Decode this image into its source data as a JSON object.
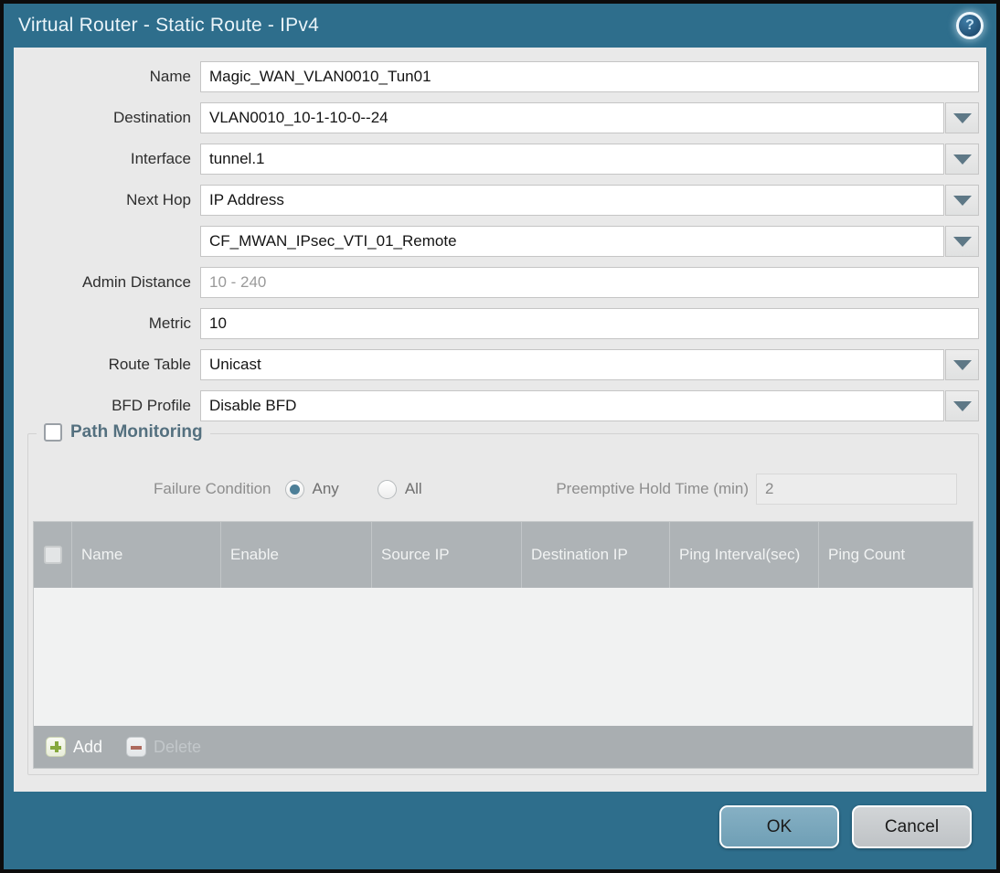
{
  "dialog": {
    "title": "Virtual Router - Static Route - IPv4",
    "help_glyph": "?"
  },
  "form": {
    "name": {
      "label": "Name",
      "value": "Magic_WAN_VLAN0010_Tun01"
    },
    "destination": {
      "label": "Destination",
      "value": "VLAN0010_10-1-10-0--24"
    },
    "interface": {
      "label": "Interface",
      "value": "tunnel.1"
    },
    "next_hop": {
      "label": "Next Hop",
      "value": "IP Address"
    },
    "next_hop_address": {
      "value": "CF_MWAN_IPsec_VTI_01_Remote"
    },
    "admin_distance": {
      "label": "Admin Distance",
      "placeholder": "10 - 240"
    },
    "metric": {
      "label": "Metric",
      "value": "10"
    },
    "route_table": {
      "label": "Route Table",
      "value": "Unicast"
    },
    "bfd_profile": {
      "label": "BFD Profile",
      "value": "Disable BFD"
    }
  },
  "path_monitoring": {
    "title": "Path Monitoring",
    "checkbox_checked": false,
    "failure_condition": {
      "label": "Failure Condition",
      "options": [
        "Any",
        "All"
      ],
      "selected": "Any"
    },
    "preemptive_hold_time": {
      "label": "Preemptive Hold Time (min)",
      "value": "2"
    },
    "table": {
      "columns": [
        "Name",
        "Enable",
        "Source IP",
        "Destination IP",
        "Ping Interval(sec)",
        "Ping Count"
      ],
      "rows": []
    },
    "add_label": "Add",
    "delete_label": "Delete"
  },
  "footer": {
    "ok_label": "OK",
    "cancel_label": "Cancel"
  },
  "colors": {
    "frame_teal": "#2e6e8c",
    "content_bg": "#e9e9e9",
    "table_header_bg": "#aeb3b6",
    "table_footer_bg": "#a9aeb1",
    "ok_button": "#7aa9be",
    "cancel_button": "#c8ccce",
    "radio_selected": "#4d7f98",
    "pm_title": "#54707f",
    "add_plus": "#86a93e",
    "delete_minus": "#ad6a5e"
  }
}
